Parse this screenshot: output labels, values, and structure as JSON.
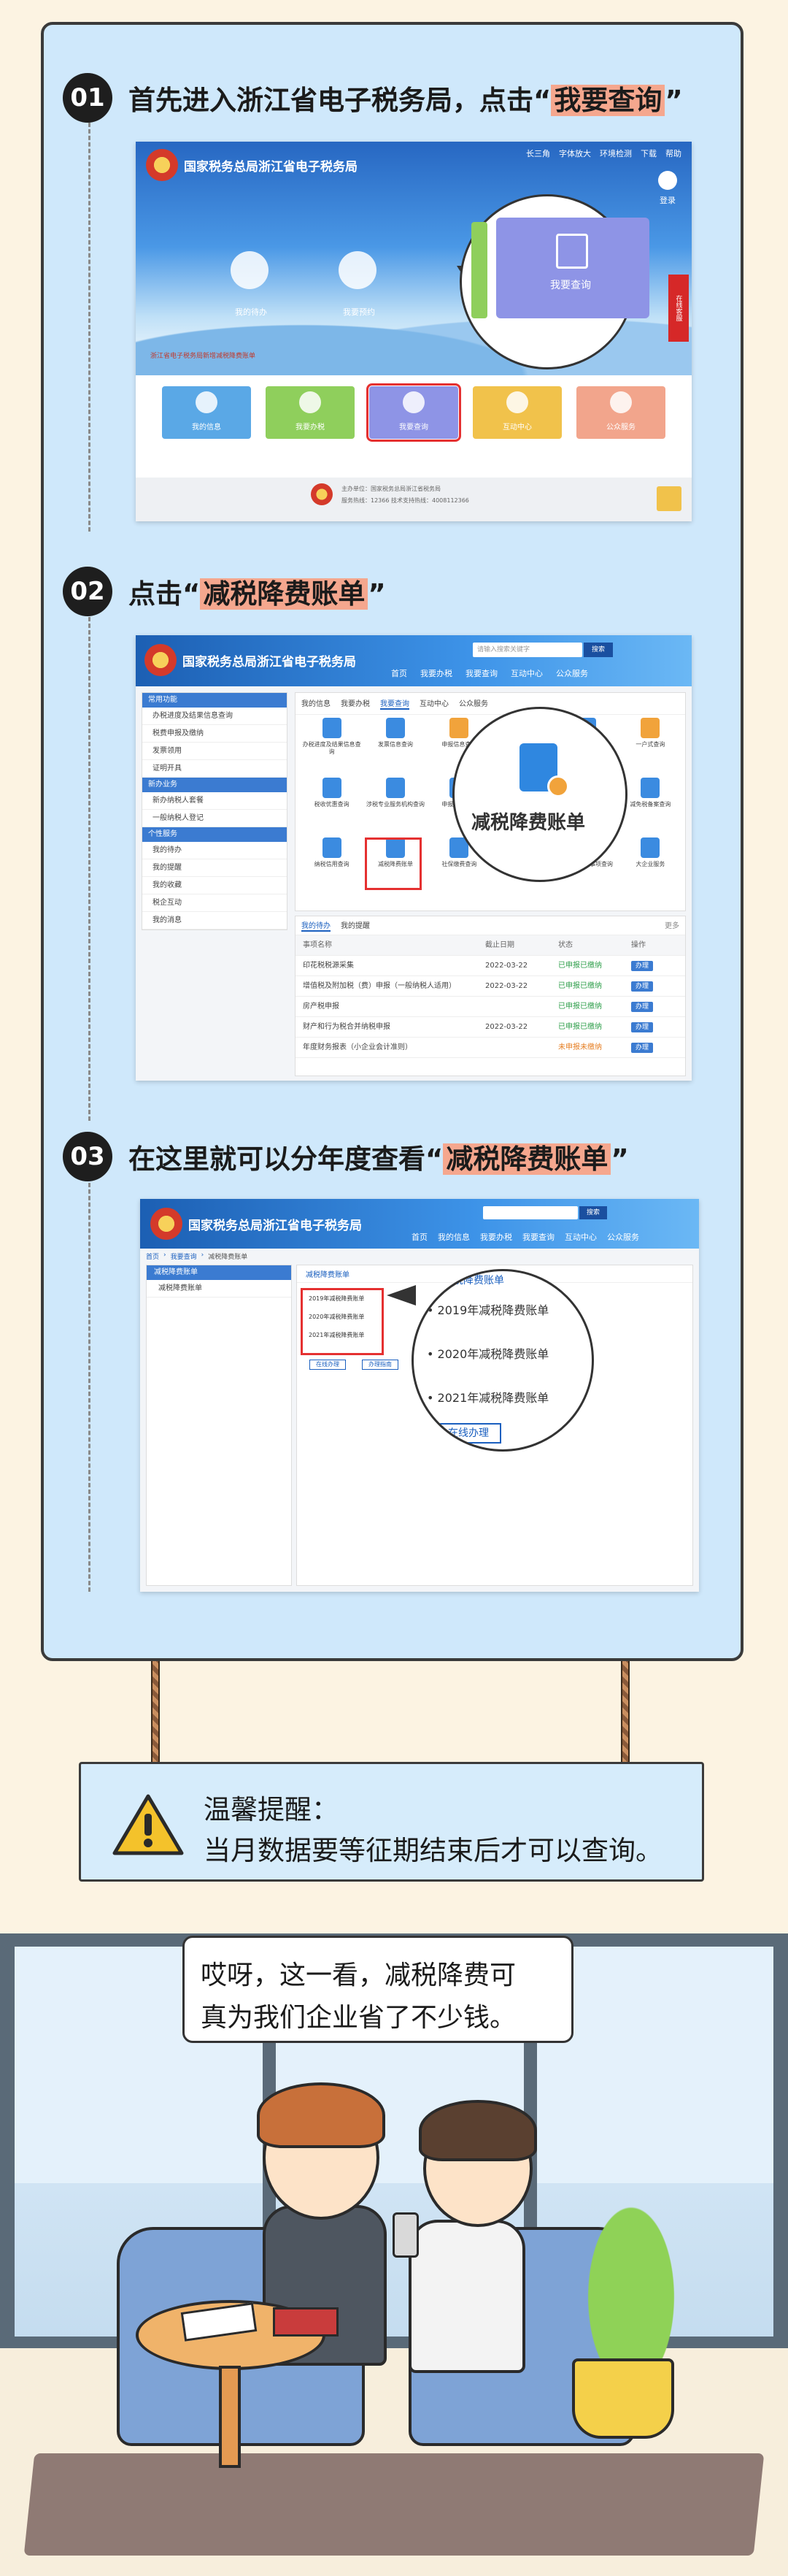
{
  "steps": [
    {
      "num": "01",
      "text_before": "首先进入浙江省电子税务局，点击“",
      "highlight": "我要查询",
      "text_after": "”"
    },
    {
      "num": "02",
      "text_before": "点击“",
      "highlight": "减税降费账单",
      "text_after": "”"
    },
    {
      "num": "03",
      "text_before": "在这里就可以分年度查看“",
      "highlight": "减税降费账单",
      "text_after": "”"
    }
  ],
  "shot1": {
    "site_title": "国家税务总局浙江省电子税务局",
    "top_links": [
      "长三角",
      "字体放大",
      "环境检测",
      "下载",
      "帮助"
    ],
    "login_label": "登录",
    "banner_btns": [
      "我的待办",
      "我要预约"
    ],
    "notice": "浙江省电子税务局新增减税降费账单",
    "tiles": [
      "我的信息",
      "我要办税",
      "我要查询",
      "互动中心",
      "公众服务"
    ],
    "zoom_label": "我要查询",
    "side_tab": "在线客服",
    "footer_line1": "主办单位：国家税务总局浙江省税务局",
    "footer_line2": "服务热线：12366 技术支持热线：4008112366"
  },
  "shot2": {
    "site_title": "国家税务总局浙江省电子税务局",
    "search_placeholder": "请输入搜索关键字",
    "search_btn": "搜索",
    "nav": [
      "首页",
      "我要办税",
      "我要查询",
      "互动中心",
      "公众服务"
    ],
    "sidebar": [
      {
        "head": "常用功能",
        "items": [
          "办税进度及结果信息查询",
          "税费申报及缴纳",
          "发票领用",
          "证明开具"
        ]
      },
      {
        "head": "新办业务",
        "items": [
          "新办纳税人套餐",
          "一般纳税人登记"
        ]
      },
      {
        "head": "个性服务",
        "items": [
          "我的待办",
          "我的提醒",
          "我的收藏",
          "税企互动",
          "我的消息"
        ]
      }
    ],
    "tabs": [
      "我的信息",
      "我要办税",
      "我要查询",
      "互动中心",
      "公众服务"
    ],
    "icons": [
      "办税进度及结果信息查询",
      "发票信息查询",
      "申报信息查询",
      "缴款信息查询",
      "涉税资格查询",
      "一户式查询",
      "税收优惠查询",
      "涉税专业服务机构查询",
      "申报缴款查询",
      "纳税信用查询",
      "文书查询",
      "减免税备案查询",
      "纳税信用查询",
      "减税降费账单",
      "社保缴费查询",
      "非居民备案查询",
      "跨区域涉税事项查询",
      "大企业服务"
    ],
    "zoom_label": "减税降费账单",
    "lower_tabs": [
      "我的待办",
      "我的提醒"
    ],
    "more": "更多",
    "table_head": [
      "事项名称",
      "截止日期",
      "状态",
      "操作"
    ],
    "rows": [
      [
        "印花税税源采集",
        "2022-03-22",
        "已申报已缴纳",
        "办理"
      ],
      [
        "增值税及附加税（费）申报（一般纳税人适用）",
        "2022-03-22",
        "已申报已缴纳",
        "办理"
      ],
      [
        "房产税申报",
        "",
        "已申报已缴纳",
        "办理"
      ],
      [
        "财产和行为税合并纳税申报",
        "2022-03-22",
        "已申报已缴纳",
        "办理"
      ],
      [
        "年度财务报表（小企业会计准则）",
        "",
        "未申报未缴纳",
        "办理"
      ]
    ]
  },
  "shot3": {
    "site_title": "国家税务总局浙江省电子税务局",
    "search_btn": "搜索",
    "nav": [
      "首页",
      "我的信息",
      "我要办税",
      "我要查询",
      "互动中心",
      "公众服务"
    ],
    "breadcrumb": [
      "首页",
      "我要查询",
      "减税降费账单"
    ],
    "side_head": "减税降费账单",
    "side_item": "减税降费账单",
    "panel_title": "减税降费账单",
    "items": [
      "2019年减税降费账单",
      "2020年减税降费账单",
      "2021年减税降费账单"
    ],
    "buttons": [
      "在线办理",
      "办理指南"
    ]
  },
  "tip": {
    "title": "温馨提醒：",
    "body": "当月数据要等征期结束后才可以查询。"
  },
  "speech": {
    "line1": "哎呀，这一看，减税降费可",
    "line2": "真为我们企业省了不少钱。"
  },
  "colors": {
    "board": "#cfe8fb",
    "highlight": "#f5a78e",
    "tile_blue": "#5aa8e6",
    "tile_green": "#8fcf5c",
    "tile_purple": "#8e94e6",
    "tile_yellow": "#f1c24b",
    "tile_pink": "#f2a58c",
    "red_box": "#e53030"
  }
}
